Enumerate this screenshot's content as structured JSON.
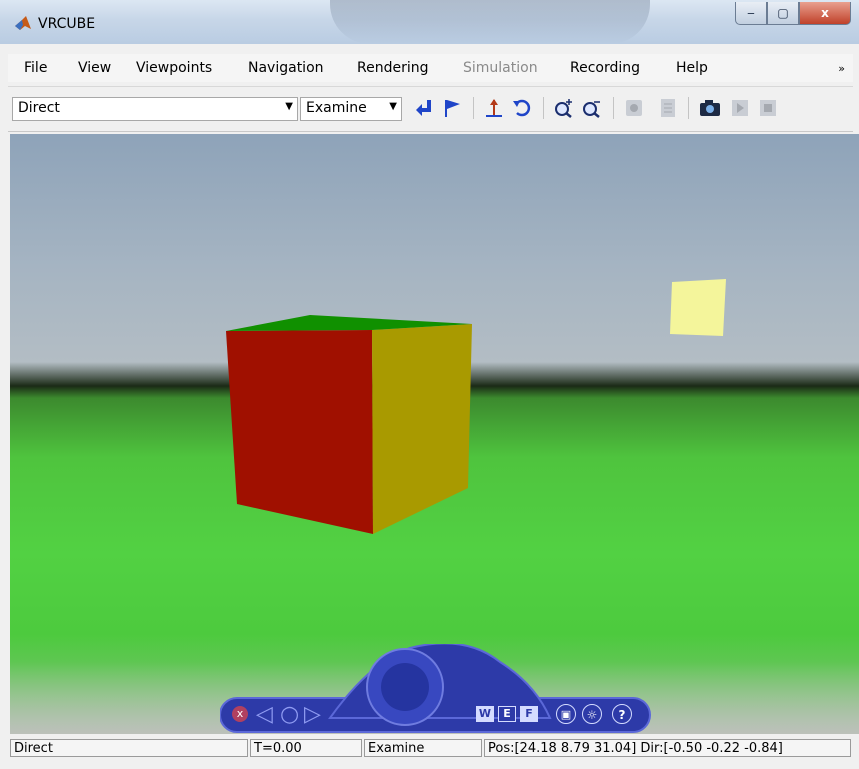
{
  "window": {
    "title": "VRCUBE",
    "caption": {
      "minimize": "‒",
      "maximize": "▢",
      "close": "x"
    }
  },
  "menubar": {
    "items": [
      {
        "label": "File"
      },
      {
        "label": "View"
      },
      {
        "label": "Viewpoints"
      },
      {
        "label": "Navigation"
      },
      {
        "label": "Rendering"
      },
      {
        "label": "Simulation",
        "disabled": true
      },
      {
        "label": "Recording"
      },
      {
        "label": "Help"
      }
    ],
    "overflow": "»"
  },
  "toolbar": {
    "viewpoint_combo": {
      "value": "Direct"
    },
    "navmode_combo": {
      "value": "Examine"
    },
    "icons": [
      "return-icon",
      "flag-icon",
      "straighten-icon",
      "undo-move-icon",
      "zoom-in-icon",
      "zoom-out-icon",
      "record-icon",
      "capture-list-icon",
      "camera-icon",
      "play-icon",
      "stop-icon"
    ]
  },
  "navpanel": {
    "wef": [
      "W",
      "E",
      "F"
    ],
    "help_label": "?"
  },
  "statusbar": {
    "viewpoint": "Direct",
    "time": "T=0.00",
    "navmode": "Examine",
    "posdir": "Pos:[24.18 8.79 31.04] Dir:[-0.50 -0.22 -0.84]"
  },
  "colors": {
    "cube_front": "#a01000",
    "cube_side": "#a99a00",
    "cube_top": "#109000",
    "light_patch": "#f4f59b",
    "nav_blue": "#2d3aa8"
  }
}
